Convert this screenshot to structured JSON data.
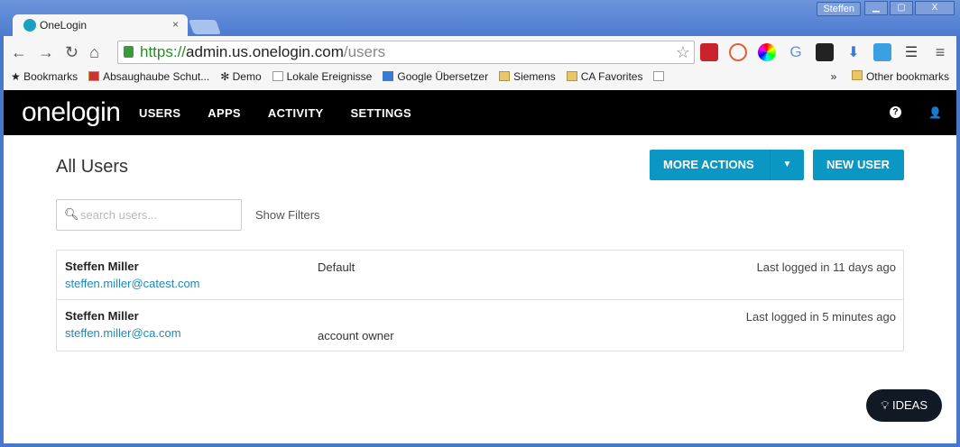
{
  "browser": {
    "profile": "Steffen",
    "tab_title": "OneLogin",
    "url_scheme": "https://",
    "url_host": "admin.us.onelogin.com",
    "url_path": "/users",
    "bookmarks": [
      "Bookmarks",
      "Absaughaube Schut...",
      "Demo",
      "Lokale Ereignisse",
      "Google Übersetzer",
      "Siemens",
      "CA Favorites"
    ],
    "other_bookmarks": "Other bookmarks",
    "overflow": "»"
  },
  "nav": {
    "logo": "onelogin",
    "items": [
      "USERS",
      "APPS",
      "ACTIVITY",
      "SETTINGS"
    ],
    "help": "?",
    "user": "👤"
  },
  "main": {
    "title": "All Users",
    "more_actions": "MORE ACTIONS",
    "new_user": "NEW USER",
    "search_placeholder": "search users...",
    "show_filters": "Show Filters"
  },
  "users": [
    {
      "name": "Steffen Miller",
      "email": "steffen.miller@catest.com",
      "role": "Default",
      "last": "Last logged in 11 days ago"
    },
    {
      "name": "Steffen Miller",
      "email": "steffen.miller@ca.com",
      "role": "account owner",
      "last": "Last logged in 5 minutes ago"
    }
  ],
  "ideas": "IDEAS"
}
